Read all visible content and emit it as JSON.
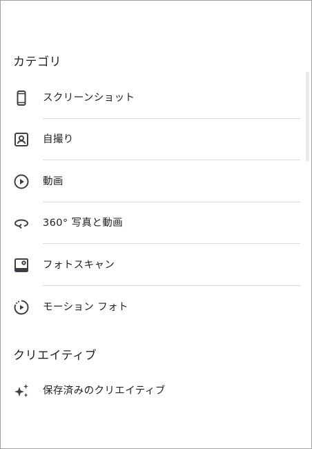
{
  "sections": [
    {
      "title": "カテゴリ",
      "items": [
        {
          "label": "スクリーンショット",
          "icon": "phone-icon"
        },
        {
          "label": "自撮り",
          "icon": "portrait-icon"
        },
        {
          "label": "動画",
          "icon": "play-circle-icon"
        },
        {
          "label": "360° 写真と動画",
          "icon": "360-rotate-icon"
        },
        {
          "label": "フォトスキャン",
          "icon": "photoscan-icon"
        },
        {
          "label": "モーション フォト",
          "icon": "motion-photo-icon"
        }
      ]
    },
    {
      "title": "クリエイティブ",
      "items": [
        {
          "label": "保存済みのクリエイティブ",
          "icon": "sparkle-icon"
        }
      ]
    }
  ],
  "colors": {
    "text": "#202124",
    "icon": "#3c4043",
    "divider": "#dadce0",
    "scrollbar": "#e8eaed"
  }
}
